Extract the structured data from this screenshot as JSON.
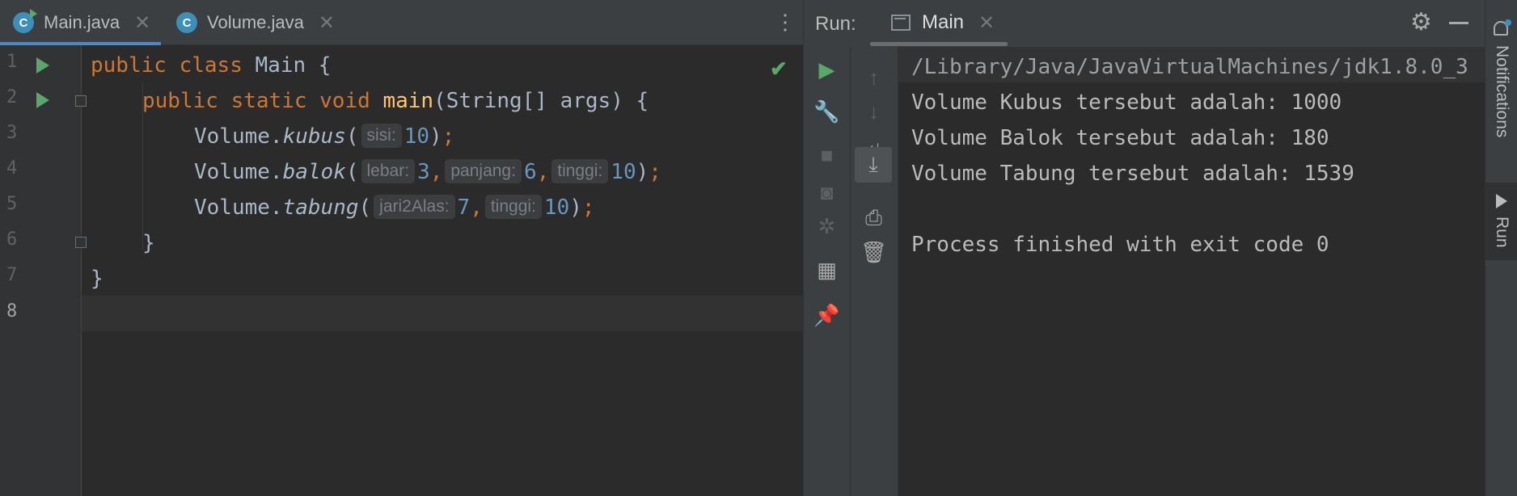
{
  "editor": {
    "tabs": [
      {
        "label": "Main.java",
        "icon": "java-class-run-icon",
        "active": true
      },
      {
        "label": "Volume.java",
        "icon": "java-class-icon",
        "active": false
      }
    ],
    "more_label": "⋮",
    "line_numbers": [
      "1",
      "2",
      "3",
      "4",
      "5",
      "6",
      "7",
      "8"
    ],
    "code": {
      "l1": {
        "kw1": "public",
        "kw2": "class",
        "name": " Main {"
      },
      "l2": {
        "kw1": "public",
        "kw2": "static",
        "kw3": "void",
        "fn": "main",
        "rest": "(String[] args) {"
      },
      "l3": {
        "obj": "Volume.",
        "method": "kubus",
        "open": "(",
        "hint1": "sisi:",
        "v1": "10",
        "close": ")",
        "semi": ";"
      },
      "l4": {
        "obj": "Volume.",
        "method": "balok",
        "open": "(",
        "hint1": "lebar:",
        "v1": "3",
        "comma": ",",
        "hint2": "panjang:",
        "v2": "6",
        "hint3": "tinggi:",
        "v3": "10",
        "close": ")",
        "semi": ";"
      },
      "l5": {
        "obj": "Volume.",
        "method": "tabung",
        "open": "(",
        "hint1": "jari2Alas:",
        "v1": "7",
        "comma": ",",
        "hint2": "tinggi:",
        "v2": "10",
        "close": ")",
        "semi": ";"
      },
      "l6": "}",
      "l7": "}"
    }
  },
  "run": {
    "label": "Run:",
    "tab_label": "Main",
    "output": [
      "/Library/Java/JavaVirtualMachines/jdk1.8.0_3",
      "Volume Kubus tersebut adalah: 1000",
      "Volume Balok tersebut adalah: 180",
      "Volume Tabung tersebut adalah: 1539",
      "",
      "Process finished with exit code 0"
    ]
  },
  "stripe": {
    "notifications_label": "Notifications",
    "run_label": "Run"
  },
  "colors": {
    "keyword": "#cc7832",
    "function": "#ffc66d",
    "number": "#6897bb",
    "run_green": "#59a869",
    "active_tab": "#4a88c7"
  }
}
